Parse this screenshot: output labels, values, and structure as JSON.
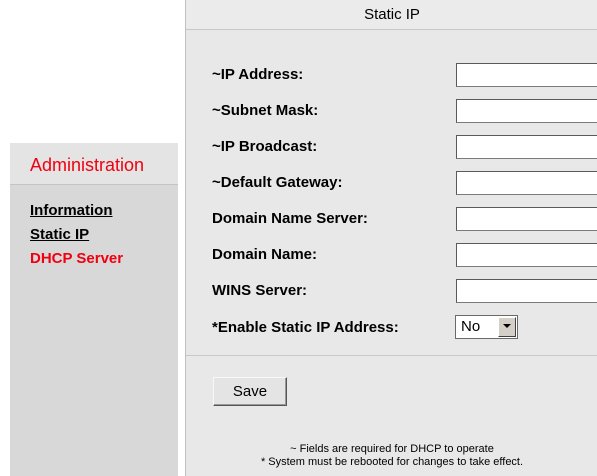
{
  "sidebar": {
    "title": "Administration",
    "items": [
      {
        "label": "Information"
      },
      {
        "label": "Static IP"
      },
      {
        "label": "DHCP Server"
      }
    ]
  },
  "panel": {
    "title": "Static IP",
    "fields": [
      {
        "label": "~IP Address:",
        "value": ""
      },
      {
        "label": "~Subnet Mask:",
        "value": ""
      },
      {
        "label": "~IP Broadcast:",
        "value": ""
      },
      {
        "label": "~Default Gateway:",
        "value": ""
      },
      {
        "label": "Domain Name Server:",
        "value": ""
      },
      {
        "label": "Domain Name:",
        "value": ""
      },
      {
        "label": "WINS Server:",
        "value": ""
      }
    ],
    "enable_static": {
      "label": "*Enable Static IP Address:",
      "selected": "No"
    },
    "save_label": "Save",
    "notes": [
      "~ Fields are required for DHCP to operate",
      "* System must be rebooted for changes to take effect."
    ]
  },
  "colors": {
    "accent_red": "#f00010",
    "panel_bg": "#e8e8e8",
    "sidebar_bg": "#d8d8d8"
  }
}
